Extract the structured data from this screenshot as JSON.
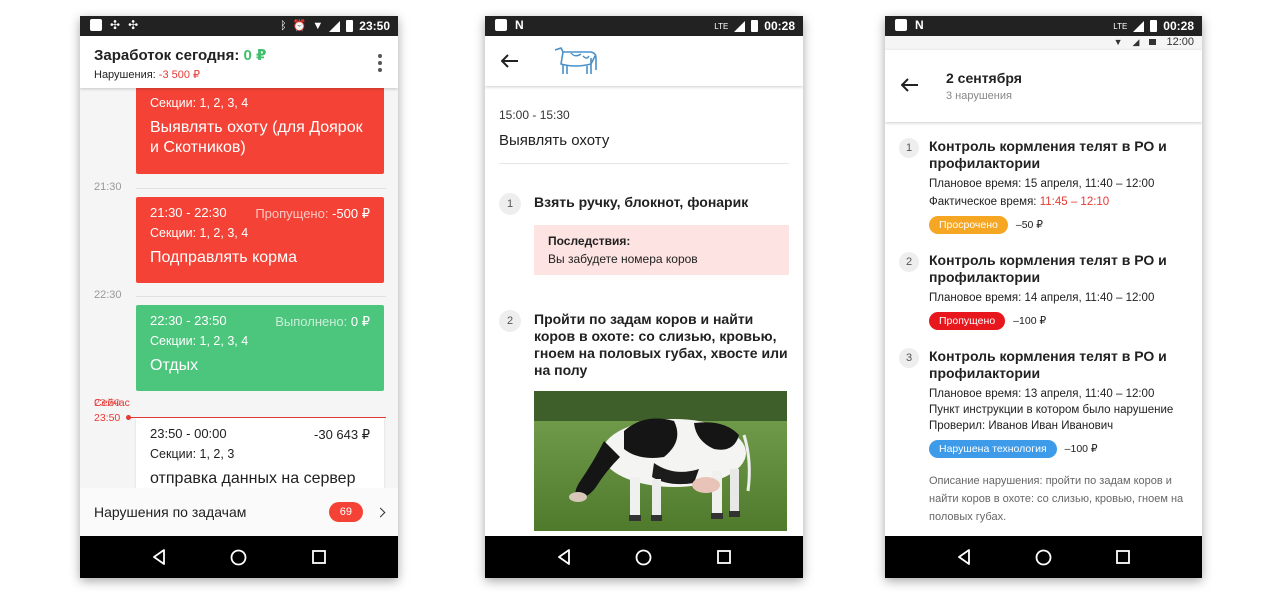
{
  "phone1": {
    "status_time": "23:50",
    "appbar": {
      "title_prefix": "Заработок сегодня:",
      "title_value": "0 ₽",
      "sub_prefix": "Нарушения:",
      "sub_value": "-3 500 ₽"
    },
    "hours": [
      "21:30",
      "22:30"
    ],
    "cards": [
      {
        "sections": "Секции: 1, 2, 3, 4",
        "title": "Выявлять охоту (для Доярок и Скотников)"
      },
      {
        "time": "21:30 - 22:30",
        "status_label": "Пропущено:",
        "status_value": "-500 ₽",
        "sections": "Секции: 1, 2, 3, 4",
        "title": "Подправлять корма"
      },
      {
        "time": "22:30 - 23:50",
        "status_label": "Выполнено:",
        "status_value": "0 ₽",
        "sections": "Секции: 1, 2, 3, 4",
        "title": "Отдых"
      },
      {
        "time": "23:50 - 00:00",
        "amount": "-30 643 ₽",
        "sections": "Секции: 1, 2, 3",
        "title": "отправка данных на сервер"
      }
    ],
    "now_label_a": "Сейчас",
    "now_label_b": "23:50",
    "now_time": "23:50",
    "violations_label": "Нарушения по задачам",
    "violations_count": "69"
  },
  "phone2": {
    "status_time": "00:28",
    "task_time": "15:00 - 15:30",
    "task_title": "Выявлять охоту",
    "steps": [
      {
        "num": "1",
        "text": "Взять ручку, блокнот, фонарик"
      },
      {
        "num": "2",
        "text": "Пройти по задам коров и найти коров в охоте: со слизью, кровью, гноем на половых губах, хвосте или на полу"
      }
    ],
    "consequence_title": "Последствия:",
    "consequence_text": "Вы забудете номера коров"
  },
  "phone3": {
    "status_time": "00:28",
    "sys_time": "12:00",
    "title": "2 сентября",
    "subtitle": "3 нарушения",
    "items": [
      {
        "num": "1",
        "title": "Контроль кормления телят в РО и профилактории",
        "planned": "Плановое время: 15 апреля, 11:40 – 12:00",
        "actual_label": "Фактическое время:",
        "actual_value": "11:45 – 12:10",
        "tag": "Просрочено",
        "fine": "–50 ₽"
      },
      {
        "num": "2",
        "title": "Контроль кормления телят в РО и профилактории",
        "planned": "Плановое время: 14 апреля, 11:40 – 12:00",
        "tag": "Пропущено",
        "fine": "–100 ₽"
      },
      {
        "num": "3",
        "title": "Контроль кормления телят в РО и профилактории",
        "planned": "Плановое время: 13 апреля, 11:40 – 12:00",
        "line2": "Пункт инструкции в котором было нарушение",
        "line3": "Проверил: Иванов Иван Иванович",
        "tag": "Нарушена технология",
        "fine": "–100 ₽"
      }
    ],
    "description": "Описание нарушения: пройти по задам коров и найти коров в охоте: со слизью, кровью, гноем на половых губах."
  },
  "colors": {
    "red": "#f44336",
    "green": "#4cc67d",
    "orange": "#f5a623",
    "blue": "#3d9be9"
  },
  "icons": [
    "image-icon",
    "fan-icon",
    "bluetooth-icon",
    "alarm-icon",
    "wifi-icon",
    "signal-icon",
    "battery-icon",
    "sim-icon",
    "n-icon",
    "lte-icon",
    "back-arrow-icon",
    "cow-logo-icon",
    "nav-back-icon",
    "nav-home-icon",
    "nav-recents-icon",
    "kebab-menu-icon",
    "chevron-right-icon"
  ]
}
